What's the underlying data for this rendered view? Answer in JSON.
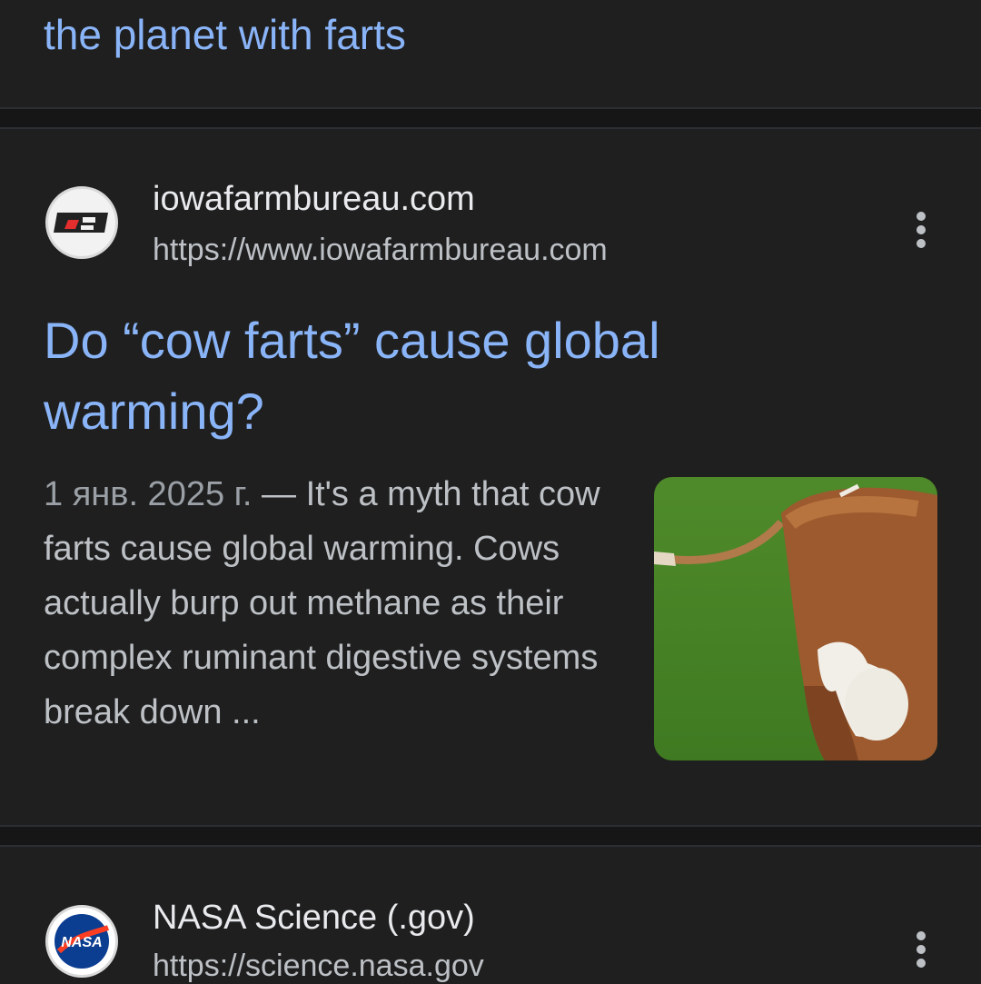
{
  "previous_result": {
    "title_tail": "the planet with farts"
  },
  "result_1": {
    "site_name": "iowafarmbureau.com",
    "site_url": "https://www.iowafarmbureau.com",
    "title": "Do “cow farts” cause global warming?",
    "date": "1 янв. 2025 г.",
    "separator": " — ",
    "snippet": "It's a myth that cow farts cause global warming. Cows actually burp out methane as their complex ruminant digestive systems break down ...",
    "favicon_icon": "iowa-farm-bureau-logo",
    "thumbnail": "cow-in-grass-image"
  },
  "result_2": {
    "site_name": "NASA Science (.gov)",
    "site_url": "https://science.nasa.gov",
    "favicon_icon": "nasa-logo"
  },
  "colors": {
    "background": "#1f1f1f",
    "link": "#8ab4f8",
    "text_primary": "#e8eaed",
    "text_secondary": "#bdc1c6"
  }
}
